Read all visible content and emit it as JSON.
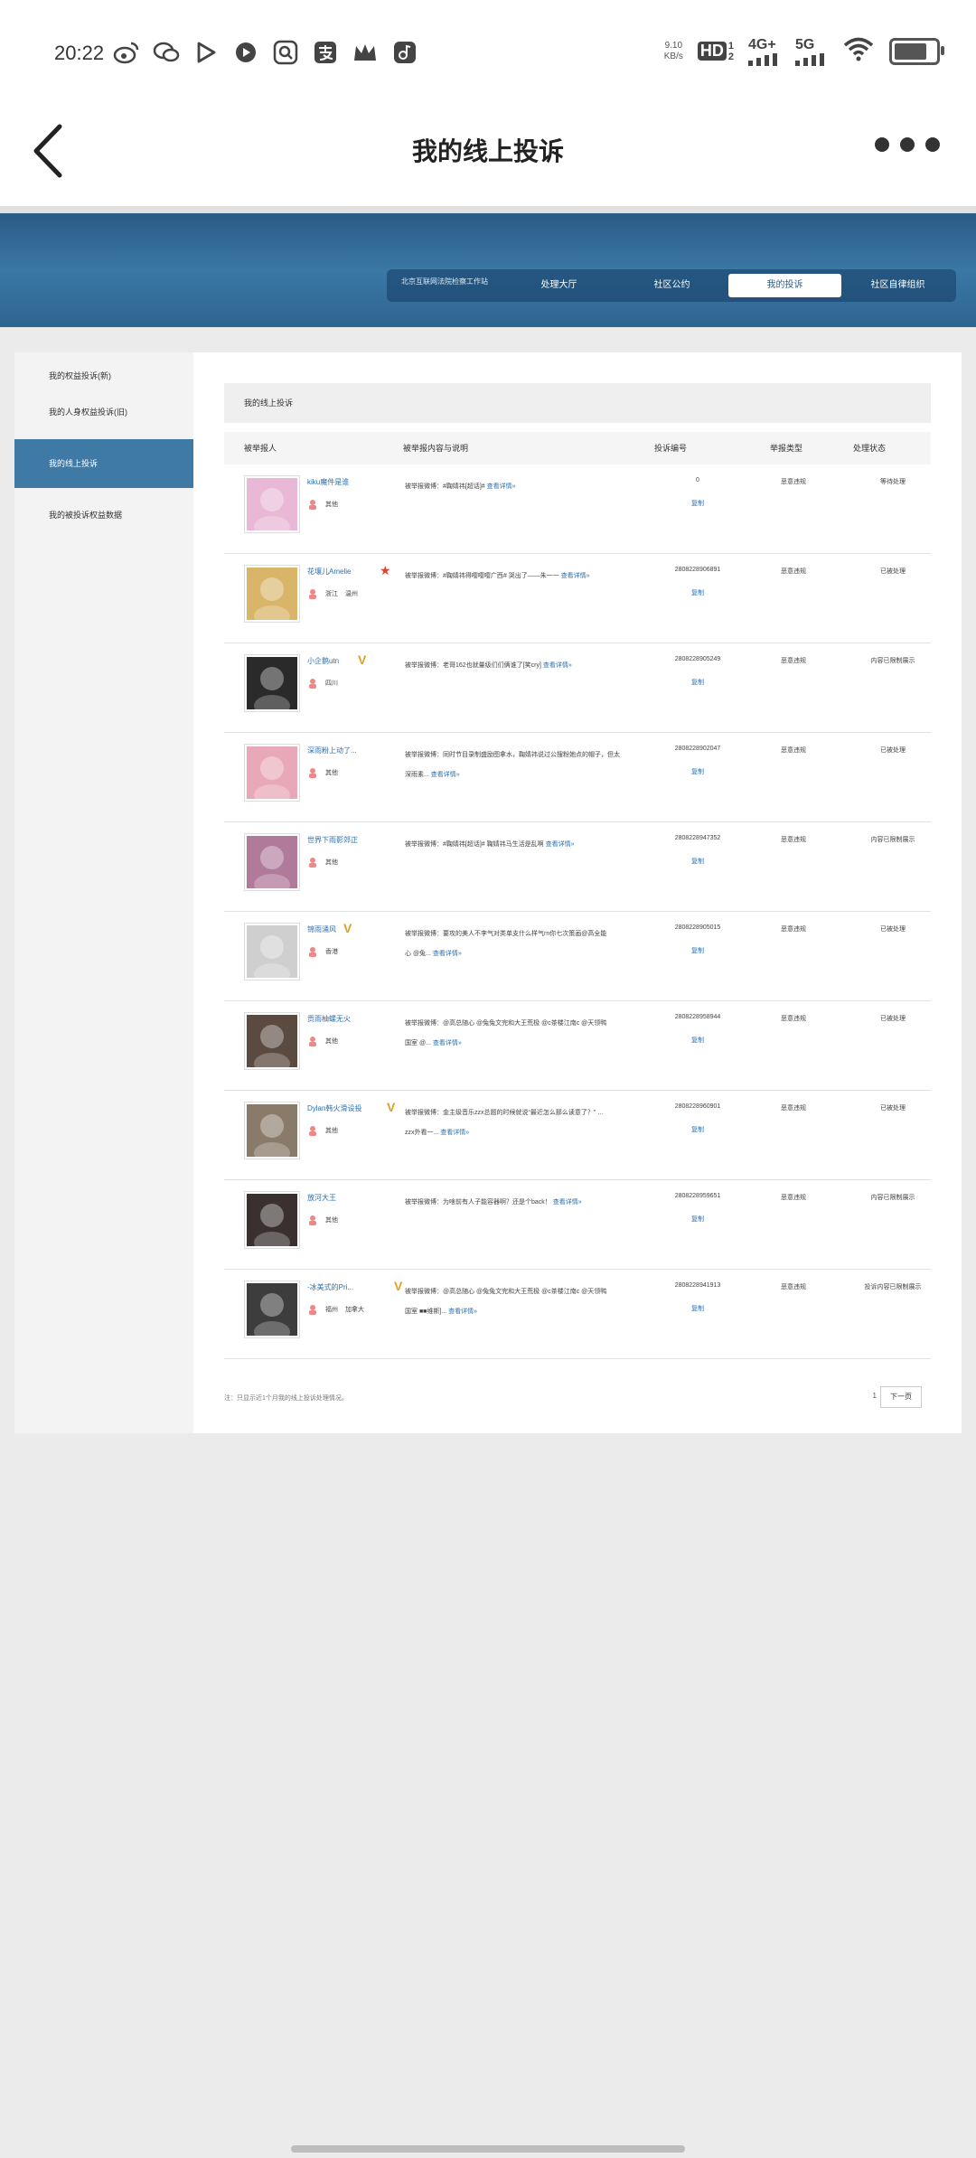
{
  "status_bar": {
    "time": "20:22",
    "app_icons": [
      "weibo-icon",
      "wechat-icon",
      "play-icon",
      "video-icon",
      "search-app-icon",
      "alipay-icon",
      "crown-icon",
      "music-icon"
    ],
    "speed_value": "9.10",
    "speed_unit": "KB/s",
    "hd": "HD",
    "hd_sup": "1",
    "hd_sub": "2",
    "net1": "4G+",
    "net2": "5G"
  },
  "app_bar": {
    "title": "我的线上投诉"
  },
  "banner": {
    "org": "北京互联网法院检察工作站",
    "tabs": [
      {
        "label": "处理大厅"
      },
      {
        "label": "社区公约"
      },
      {
        "label": "我的投诉",
        "active": true
      },
      {
        "label": "社区自律组织"
      }
    ]
  },
  "sidebar": {
    "items": [
      {
        "label": "我的权益投诉(新)"
      },
      {
        "label": "我的人身权益投诉(旧)"
      },
      {
        "label": "我的线上投诉",
        "active": true
      },
      {
        "label": "我的被投诉权益数据"
      }
    ]
  },
  "main": {
    "title": "我的线上投诉",
    "headers": [
      "被举报人",
      "被举报内容与说明",
      "投诉编号",
      "举报类型",
      "处理状态"
    ],
    "rows": [
      {
        "name": "kiku魔件是谁",
        "vip": false,
        "star": false,
        "region": [
          "其他"
        ],
        "content": "被举报微博：#鞠婧祎[超话]#",
        "content2": "",
        "link": "查看详情»",
        "number": "0",
        "copy": "复制",
        "type": "恶意违规",
        "status": "等待处理",
        "avatar_color": "#e9b8d6"
      },
      {
        "name": "花壤儿Amelie",
        "vip": false,
        "star": true,
        "region": [
          "浙江",
          "温州"
        ],
        "content": "被举报微博：#鞠婧祎得嘤嘤嘤广西# 哭出了——朱一一",
        "content2": "",
        "link": "查看详情»",
        "number": "2808228906891",
        "copy": "复制",
        "type": "恶意违规",
        "status": "已被处理",
        "avatar_color": "#d9b56a"
      },
      {
        "name": "小企鹅utn",
        "vip": true,
        "star": false,
        "region": [
          "四川"
        ],
        "content": "被举报微博：老哥162也就量级们们俩谁了[笑cry]",
        "content2": "",
        "link": "查看详情»",
        "number": "2808228905249",
        "copy": "复制",
        "type": "恶意违规",
        "status": "内容已限制展示",
        "avatar_color": "#2a2a2a"
      },
      {
        "name": "深雨粉上动了...",
        "vip": false,
        "star": false,
        "region": [
          "其他"
        ],
        "content": "被举报微博：同时节目录制盛励图拿水，鞠婧祎说过公搜粉她点的帽子，但太",
        "content2": "深雨素...",
        "link": "查看详情»",
        "number": "2808228902047",
        "copy": "复制",
        "type": "恶意违规",
        "status": "已被处理",
        "avatar_color": "#e8a8b8"
      },
      {
        "name": "世界下雨影郊正",
        "vip": false,
        "star": false,
        "region": [
          "其他"
        ],
        "content": "被举报微博：#鞠婧祎[超话]# 鞠婧祎马生活是乱啊",
        "content2": "",
        "link": "查看详情»",
        "number": "2808228947352",
        "copy": "复制",
        "type": "恶意违规",
        "status": "内容已限制展示",
        "avatar_color": "#b07a9a"
      },
      {
        "name": "锦雨涌风",
        "vip": true,
        "star": false,
        "region": [
          "香港"
        ],
        "content": "被举报微博：要攻的美人不李气对类单支什么样气rn你七次策画@高全能",
        "content2": "心 @兔...",
        "link": "查看详情»",
        "number": "2808228905015",
        "copy": "复制",
        "type": "恶意违规",
        "status": "已被处理",
        "avatar_color": "#cfcfcf"
      },
      {
        "name": "贡雨柚螺无火",
        "vip": false,
        "star": false,
        "region": [
          "其他"
        ],
        "content": "被举报微博：@高总随心 @兔兔文完和大王荒极 @c茶楼江南c @天领鸭",
        "content2": "国室 @...",
        "link": "查看详情»",
        "number": "2808228958944",
        "copy": "复制",
        "type": "恶意违规",
        "status": "已被处理",
        "avatar_color": "#5a4a40"
      },
      {
        "name": "Dylan韩火滑设投",
        "vip": true,
        "star": false,
        "region": [
          "其他"
        ],
        "content": "被举报微博：金主级音乐zzx总题的时候就说“最近怎么那么读意了？” …",
        "content2": "zzx外看一...",
        "link": "查看详情»",
        "number": "2808228960901",
        "copy": "复制",
        "type": "恶意违规",
        "status": "已被处理",
        "avatar_color": "#8a7a6a"
      },
      {
        "name": "放河大王",
        "vip": false,
        "star": false,
        "region": [
          "其他"
        ],
        "content": "被举报微博：为啥前有人子能容器啊？还是个back！",
        "content2": "",
        "link": "查看详情»",
        "number": "2808228959651",
        "copy": "复制",
        "type": "恶意违规",
        "status": "内容已限制展示",
        "avatar_color": "#3a3030"
      },
      {
        "name": "-冰美式的Pri...",
        "vip": true,
        "star": false,
        "region": [
          "福州",
          "加拿大"
        ],
        "content": "被举报微博：@高总随心 @兔兔文完和大王荒极 @c茶楼江南c @天领鸭",
        "content2": "国室 ■■维斯]...",
        "link": "查看详情»",
        "number": "2808228941913",
        "copy": "复制",
        "type": "恶意违规",
        "status": "投诉内容已限制展示",
        "avatar_color": "#3d3d3d"
      }
    ],
    "footer_note": "注：只显示近1个月我的线上投诉处理情况。",
    "page": "1",
    "next": "下一页"
  }
}
